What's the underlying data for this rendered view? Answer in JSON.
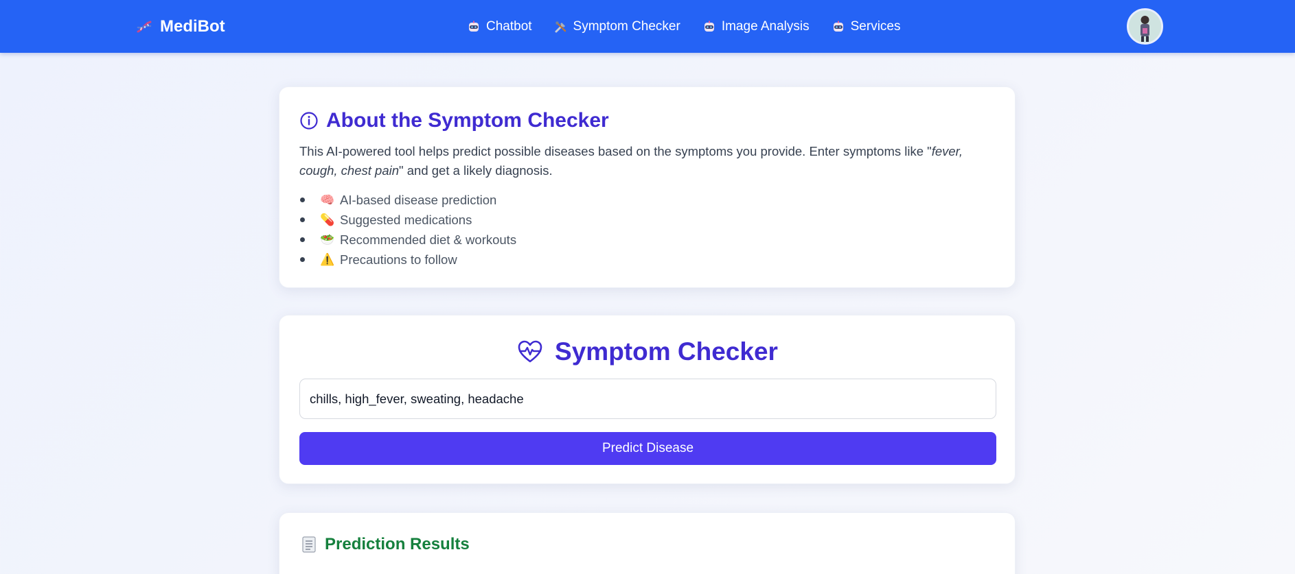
{
  "header": {
    "brand": "MediBot",
    "nav": [
      {
        "label": "Chatbot",
        "icon": "robot-icon"
      },
      {
        "label": "Symptom Checker",
        "icon": "tools-icon"
      },
      {
        "label": "Image Analysis",
        "icon": "robot-icon"
      },
      {
        "label": "Services",
        "icon": "robot-icon"
      }
    ],
    "brand_color": "#2563f5"
  },
  "about": {
    "title": "About the Symptom Checker",
    "desc_prefix": "This AI-powered tool helps predict possible diseases based on the symptoms you provide. Enter symptoms like \"",
    "desc_example": "fever, cough, chest pain",
    "desc_suffix": "\" and get a likely diagnosis.",
    "features": [
      {
        "emoji": "🧠",
        "label": "AI-based disease prediction"
      },
      {
        "emoji": "💊",
        "label": "Suggested medications"
      },
      {
        "emoji": "🥗",
        "label": "Recommended diet & workouts"
      },
      {
        "emoji": "⚠️",
        "label": "Precautions to follow"
      }
    ]
  },
  "checker": {
    "title": "Symptom Checker",
    "input_value": "chills, high_fever, sweating, headache",
    "button_label": "Predict Disease"
  },
  "results": {
    "title": "Prediction Results"
  },
  "colors": {
    "accent": "#3f2bd1",
    "button": "#4f3bf2",
    "results_title": "#15803d"
  }
}
